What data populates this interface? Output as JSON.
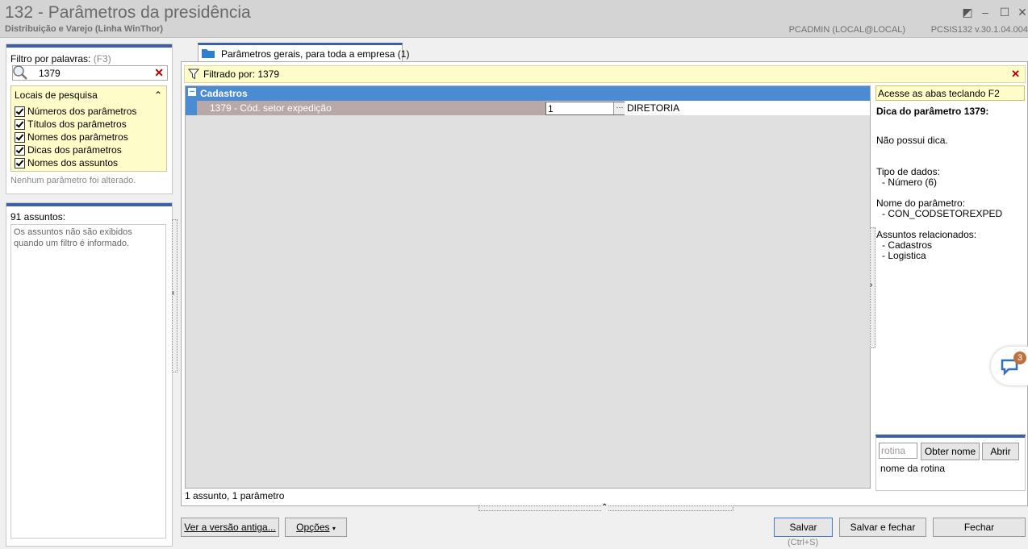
{
  "window": {
    "title": "132 - Parâmetros da presidência",
    "subtitle": "Distribuição e Varejo (Linha WinThor)",
    "user": "PCADMIN (LOCAL@LOCAL)",
    "version": "PCSIS132  v.30.1.04.004",
    "buttons": {
      "restore": "◩",
      "minimize": "–",
      "maximize": "☐",
      "close": "✕"
    }
  },
  "filter_panel": {
    "label": "Filtro por palavras:",
    "shortcut": "(F3)",
    "search_value": "1379",
    "search_icon": "magnifier-icon",
    "clear_glyph": "✕",
    "locations_title": "Locais de pesquisa",
    "collapse_glyph": "⌃",
    "options": [
      {
        "label": "Números dos parâmetros",
        "checked": true
      },
      {
        "label": "Títulos dos parâmetros",
        "checked": true
      },
      {
        "label": "Nomes dos parâmetros",
        "checked": true
      },
      {
        "label": "Dicas dos parâmetros",
        "checked": true
      },
      {
        "label": "Nomes dos assuntos",
        "checked": true
      }
    ],
    "status": "Nenhum parâmetro foi alterado."
  },
  "subjects_panel": {
    "count_label": "91 assuntos:",
    "message": "Os assuntos não são exibidos quando um filtro é informado."
  },
  "tab": {
    "label": "Parâmetros gerais, para toda a empresa",
    "count": "(1)"
  },
  "filter_bar": {
    "label": "Filtrado por: 1379",
    "close_glyph": "✕"
  },
  "grid": {
    "group": {
      "expander": "−",
      "label": "Cadastros"
    },
    "rows": [
      {
        "label": "1379 - Cód. setor expedição",
        "value": "1",
        "ellipsis": "···",
        "description": "DIRETORIA"
      }
    ]
  },
  "right_panel": {
    "hint": "Acesse as abas teclando F2",
    "tip_title": "Dica do parâmetro 1379:",
    "tip_text": "Não possui dica.",
    "data_type_label": "Tipo de dados:",
    "data_type_value": "- Número (6)",
    "param_name_label": "Nome do parâmetro:",
    "param_name_value": "- CON_CODSETOREXPED",
    "related_label": "Assuntos relacionados:",
    "related": [
      "- Cadastros",
      "- Logistica"
    ]
  },
  "routine": {
    "placeholder": "rotina",
    "get_name": "Obter nome",
    "open": "Abrir",
    "name_label": "nome da rotina"
  },
  "grid_footer": "1 assunto, 1 parâmetro",
  "chat_badge": "3",
  "bottom": {
    "old_version": "Ver a versão antiga...",
    "options": "Opções",
    "save": "Salvar",
    "save_shortcut": "(Ctrl+S)",
    "save_close": "Salvar e fechar",
    "close": "Fechar"
  },
  "colors": {
    "accent": "#3c5fa8",
    "group_header": "#4a8bd4",
    "highlight_yellow": "#fefcc8",
    "row_selected": "#b8a8a8"
  }
}
